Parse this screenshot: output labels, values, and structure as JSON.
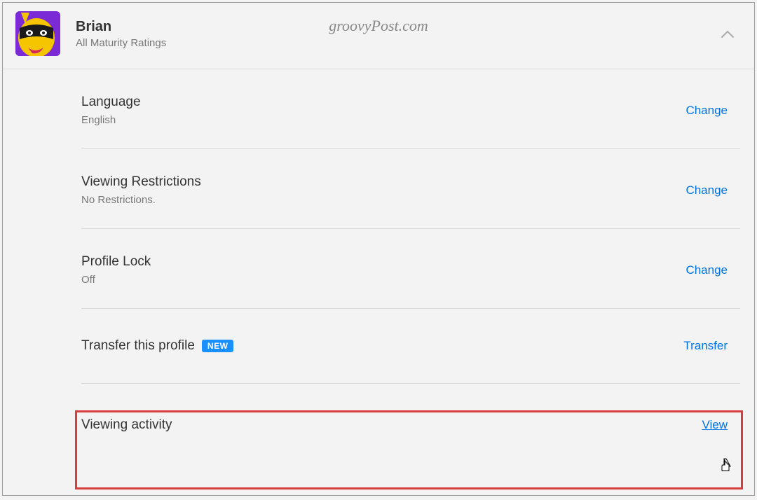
{
  "watermark": "groovyPost.com",
  "profile": {
    "name": "Brian",
    "maturity": "All Maturity Ratings"
  },
  "settings": {
    "language": {
      "title": "Language",
      "value": "English",
      "action": "Change"
    },
    "restrictions": {
      "title": "Viewing Restrictions",
      "value": "No Restrictions.",
      "action": "Change"
    },
    "lock": {
      "title": "Profile Lock",
      "value": "Off",
      "action": "Change"
    },
    "transfer": {
      "title": "Transfer this profile",
      "badge": "NEW",
      "action": "Transfer"
    },
    "activity": {
      "title": "Viewing activity",
      "action": "View"
    }
  }
}
